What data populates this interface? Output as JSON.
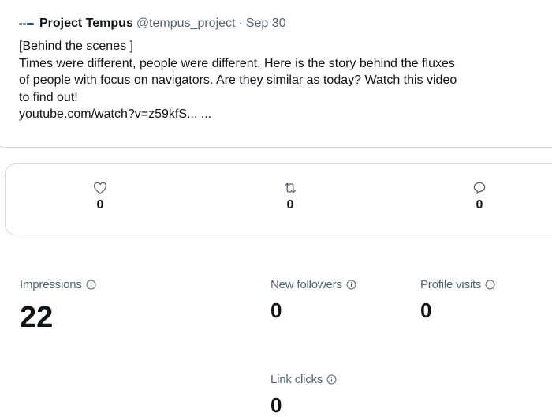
{
  "tweet": {
    "author_name": "Project Tempus",
    "author_handle": "@tempus_project",
    "separator": "·",
    "date": "Sep 30",
    "text_lines": [
      "[Behind the scenes ]",
      "Times were different, people were different. Here is the story behind the fluxes",
      "of people with focus on navigators. Are they similar as today? Watch this video",
      "to find out!"
    ],
    "link": "youtube.com/watch?v=z59kfS... ..."
  },
  "engagement": {
    "likes": {
      "icon": "heart-icon",
      "count": "0"
    },
    "retweets": {
      "icon": "retweet-icon",
      "count": "0"
    },
    "replies": {
      "icon": "reply-icon",
      "count": "0"
    }
  },
  "stats": {
    "impressions": {
      "label": "Impressions",
      "value": "22"
    },
    "new_followers": {
      "label": "New followers",
      "value": "0"
    },
    "profile_visits": {
      "label": "Profile visits",
      "value": "0"
    },
    "link_clicks": {
      "label": "Link clicks",
      "value": "0"
    }
  },
  "colors": {
    "text": "#0f1419",
    "secondary": "#536471",
    "border": "#cfd9de"
  }
}
